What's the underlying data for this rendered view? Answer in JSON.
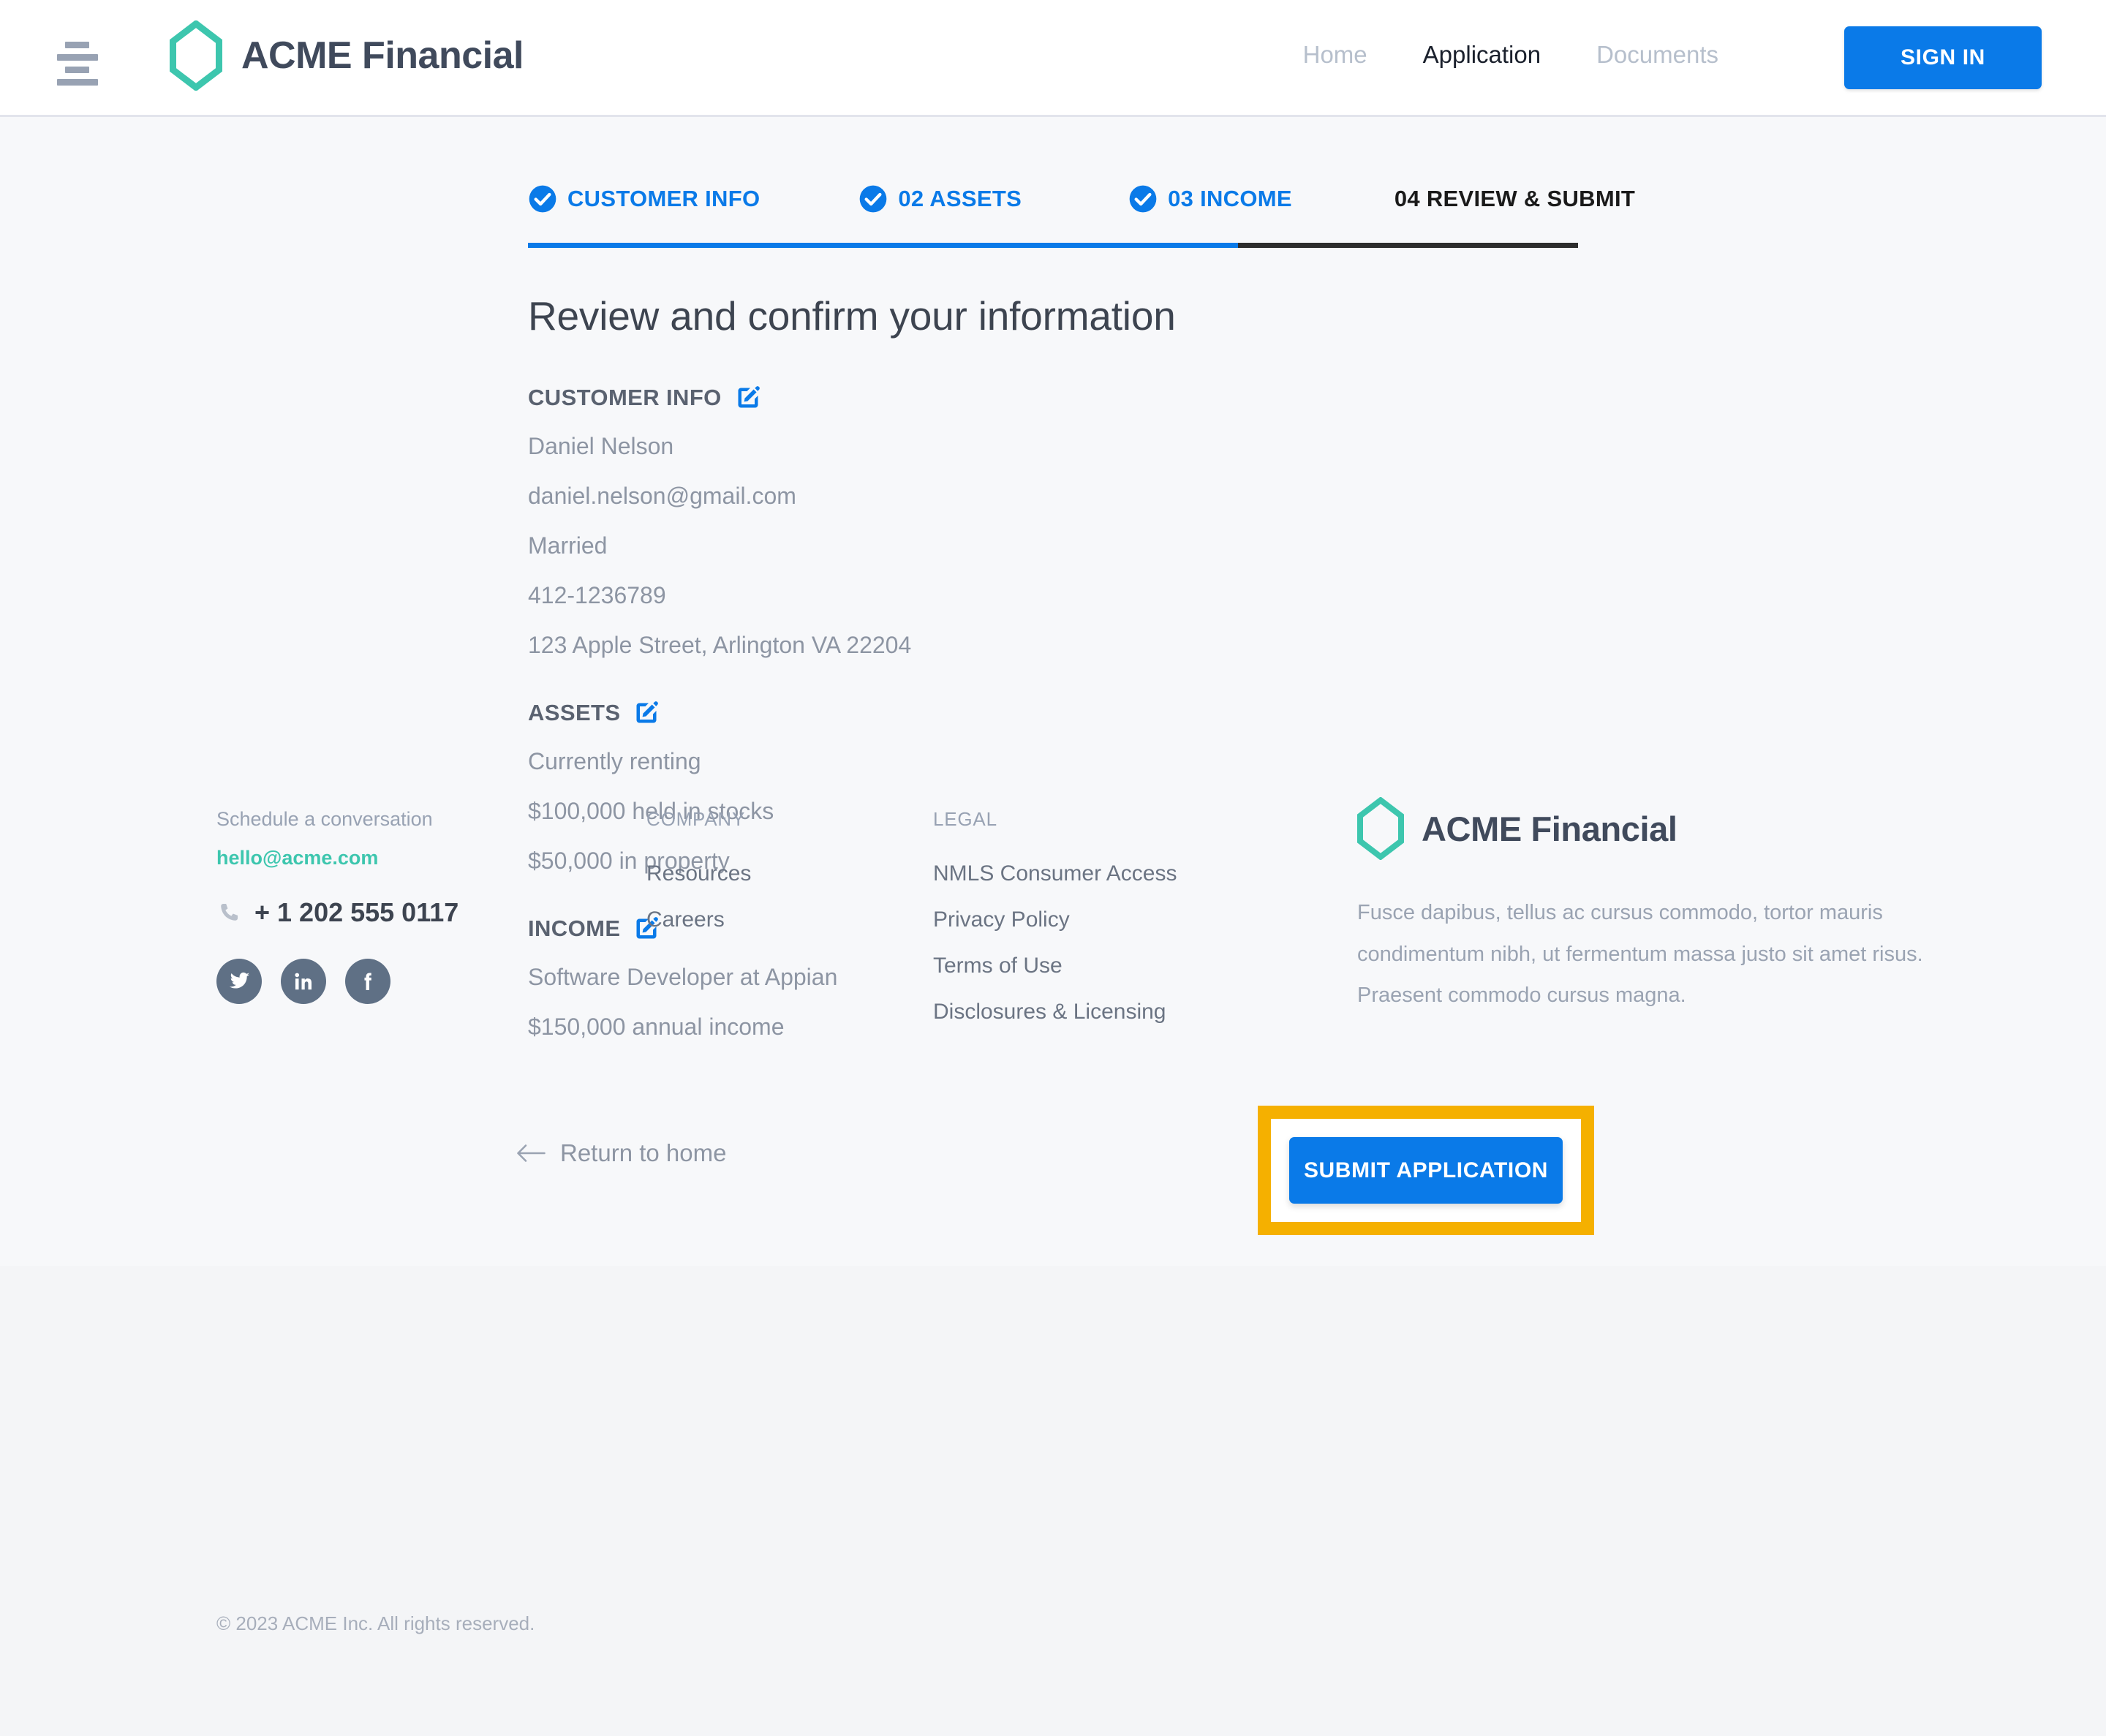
{
  "header": {
    "menu_icon": "hamburger-menu-icon",
    "logo_icon": "hexagon-logo-icon",
    "brand_name": "ACME Financial",
    "nav": [
      {
        "label": "Home",
        "state": "muted"
      },
      {
        "label": "Application",
        "state": "active"
      },
      {
        "label": "Documents",
        "state": "muted"
      }
    ],
    "sign_in_label": "SIGN IN"
  },
  "stepper": {
    "steps": [
      {
        "label": "CUSTOMER INFO",
        "completed": true,
        "icon": "check-circle-icon"
      },
      {
        "label": "02 ASSETS",
        "completed": true,
        "icon": "check-circle-icon"
      },
      {
        "label": "03 INCOME",
        "completed": true,
        "icon": "check-circle-icon"
      },
      {
        "label": "04 REVIEW & SUBMIT",
        "completed": false,
        "icon": ""
      }
    ]
  },
  "main": {
    "title": "Review and confirm your information",
    "sections": [
      {
        "title": "CUSTOMER INFO",
        "edit_icon": "edit-pencil-square-icon",
        "fields": [
          "Daniel Nelson",
          "daniel.nelson@gmail.com",
          "Married",
          "412-1236789",
          "123 Apple Street, Arlington VA 22204"
        ]
      },
      {
        "title": "ASSETS",
        "edit_icon": "edit-pencil-square-icon",
        "fields": [
          "Currently renting",
          "$100,000 held in stocks",
          "$50,000 in property"
        ]
      },
      {
        "title": "INCOME",
        "edit_icon": "edit-pencil-square-icon",
        "fields": [
          "Software Developer at Appian",
          "$150,000 annual income"
        ]
      }
    ]
  },
  "actions": {
    "return_label": "Return to home",
    "return_icon": "arrow-left-icon",
    "submit_label": "SUBMIT APPLICATION",
    "highlight_color": "#f5b000"
  },
  "footer": {
    "contact": {
      "schedule_label": "Schedule a conversation",
      "email": "hello@acme.com",
      "phone_icon": "phone-icon",
      "phone": "+ 1 202 555 0117",
      "socials": [
        {
          "name": "twitter-icon"
        },
        {
          "name": "linkedin-icon"
        },
        {
          "name": "facebook-icon"
        }
      ]
    },
    "columns": [
      {
        "title": "COMPANY",
        "links": [
          "Resources",
          "Careers"
        ]
      },
      {
        "title": "LEGAL",
        "links": [
          "NMLS Consumer Access",
          "Privacy Policy",
          "Terms of Use",
          "Disclosures & Licensing"
        ]
      }
    ],
    "brand": {
      "logo_icon": "hexagon-logo-icon",
      "name": "ACME Financial",
      "blurb": "Fusce dapibus, tellus ac cursus commodo, tortor mauris condimentum nibh, ut fermentum massa justo sit amet risus. Praesent commodo cursus magna."
    },
    "copyright": "© 2023 ACME Inc. All rights reserved."
  },
  "colors": {
    "accent_blue": "#0a7ae8",
    "brand_teal": "#3dc6ae",
    "highlight_amber": "#f5b000",
    "page_bg": "#f7f8fa",
    "footer_bg": "#f4f5f7"
  }
}
